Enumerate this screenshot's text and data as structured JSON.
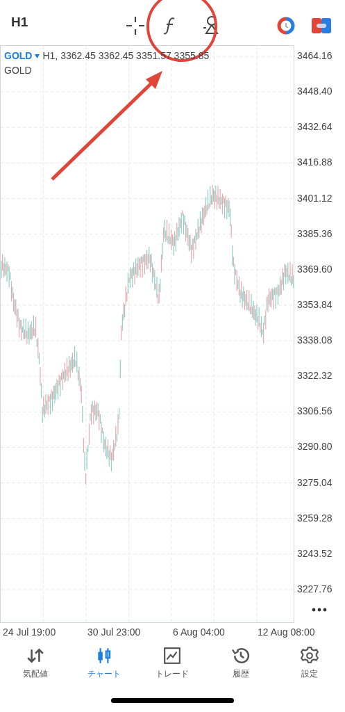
{
  "toolbar": {
    "timeframe": "H1"
  },
  "chart": {
    "symbol": "GOLD",
    "info": "H1, 3362.45 3362.45 3351.57 3355.85",
    "indicator_label": "GOLD",
    "price_labels": [
      "3464.16",
      "3448.40",
      "3432.64",
      "3416.88",
      "3401.12",
      "3385.36",
      "3369.60",
      "3353.84",
      "3338.08",
      "3322.32",
      "3306.56",
      "3290.80",
      "3275.04",
      "3259.28",
      "3243.52",
      "3227.76"
    ],
    "time_labels": [
      "24 Jul 19:00",
      "30 Jul 23:00",
      "6 Aug 04:00",
      "12 Aug 08:00"
    ]
  },
  "tabs": [
    {
      "label": "気配値",
      "kind": "quotes",
      "selected": false
    },
    {
      "label": "チャート",
      "kind": "chart",
      "selected": true
    },
    {
      "label": "トレード",
      "kind": "trade",
      "selected": false
    },
    {
      "label": "履歴",
      "kind": "history",
      "selected": false
    },
    {
      "label": "設定",
      "kind": "settings",
      "selected": false
    }
  ]
}
